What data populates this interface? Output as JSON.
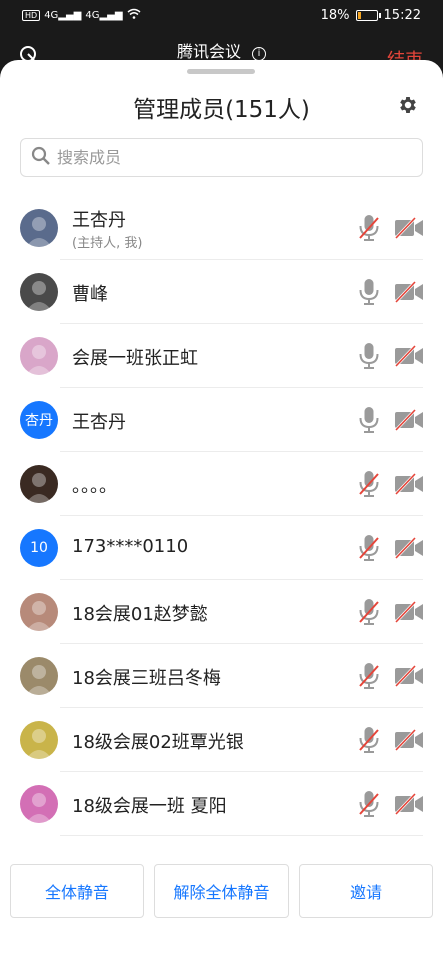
{
  "status_bar": {
    "left_icons": [
      "hd-icon",
      "signal-4g-icon",
      "signal-4g-icon",
      "wifi-icon"
    ],
    "battery_percent": "18%",
    "battery_level": 0.18,
    "time": "15:22"
  },
  "top_bar": {
    "meeting_title": "腾讯会议",
    "end_label": "结束"
  },
  "sheet": {
    "title": "管理成员(151人)",
    "search_placeholder": "搜索成员"
  },
  "members": [
    {
      "name": "王杏丹",
      "sub": "(主持人, 我)",
      "avatar": "photo",
      "avatar_color": "#5a6b8c",
      "mic": "muted",
      "cam": "off"
    },
    {
      "name": "曹峰",
      "sub": "",
      "avatar": "photo",
      "avatar_color": "#4a4a4a",
      "mic": "on",
      "cam": "off"
    },
    {
      "name": "会展一班张正虹",
      "sub": "",
      "avatar": "photo",
      "avatar_color": "#d9a6c9",
      "mic": "on",
      "cam": "off"
    },
    {
      "name": "王杏丹",
      "sub": "",
      "avatar": "杏丹",
      "avatar_color": "#1677ff",
      "mic": "on",
      "cam": "off"
    },
    {
      "name": "。。。。",
      "sub": "",
      "avatar": "photo",
      "avatar_color": "#3a2a22",
      "mic": "muted",
      "cam": "off"
    },
    {
      "name": "173****0110",
      "sub": "",
      "avatar": "10",
      "avatar_color": "#1677ff",
      "mic": "muted",
      "cam": "off"
    },
    {
      "name": "18会展01赵梦懿",
      "sub": "",
      "avatar": "photo",
      "avatar_color": "#b78a7a",
      "mic": "muted",
      "cam": "off"
    },
    {
      "name": "18会展三班吕冬梅",
      "sub": "",
      "avatar": "photo",
      "avatar_color": "#9b8a6a",
      "mic": "muted",
      "cam": "off"
    },
    {
      "name": "18级会展02班覃光银",
      "sub": "",
      "avatar": "photo",
      "avatar_color": "#c9b44a",
      "mic": "muted",
      "cam": "off"
    },
    {
      "name": "18级会展一班 夏阳",
      "sub": "",
      "avatar": "photo",
      "avatar_color": "#d36fb5",
      "mic": "muted",
      "cam": "off"
    }
  ],
  "footer": {
    "mute_all": "全体静音",
    "unmute_all": "解除全体静音",
    "invite": "邀请"
  },
  "colors": {
    "accent": "#1677ff",
    "danger": "#e5453a",
    "icon_gray": "#9a9a9a"
  }
}
